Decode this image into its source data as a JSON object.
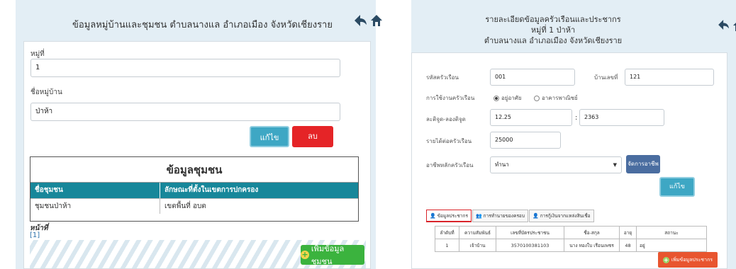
{
  "left": {
    "title": "ข้อมูลหมู่บ้านและชุมชน ตำบลนางแล อำเภอเมือง จังหวัดเชียงราย",
    "village_no_label": "หมู่ที่",
    "village_no_value": "1",
    "village_name_label": "ชื่อหมู่บ้าน",
    "village_name_value": "ป่าห้า",
    "edit_button": "แก้ไข",
    "delete_button": "ลบ",
    "community": {
      "title": "ข้อมูลชุมชน",
      "headers": [
        "ชื่อชุมชน",
        "ลักษณะที่ตั้งในเขตการปกครอง"
      ],
      "rows": [
        [
          "ชุมชนป่าห้า",
          "เขตพื้นที่ อบต"
        ]
      ]
    },
    "pager_label": "หน้าที่",
    "pager_value": "[1]",
    "add_community_button": "เพิ่มข้อมูลชุมชน"
  },
  "right": {
    "title_line1": "รายละเอียดข้อมูลครัวเรือนและประชากร",
    "title_line2": "หมู่ที่ 1  ป่าห้า",
    "title_line3": "ตำบลนางแล อำเภอเมือง จังหวัดเชียงราย",
    "household_code_label": "รหัสครัวเรือน",
    "household_code_value": "001",
    "house_no_label": "บ้านเลขที่",
    "house_no_value": "121",
    "usage_label": "การใช้งานครัวเรือน",
    "usage_options": [
      "อยู่อาศัย",
      "อาคารพาณิชย์"
    ],
    "latlon_label": "ละติจูด-ลองติจูด",
    "lat_value": "12.25",
    "lon_value": "2363",
    "income_label": "รายได้ต่อครัวเรือน",
    "income_value": "25000",
    "occupation_label": "อาชีพหลักครัวเรือน",
    "occupation_value": "ทำนา",
    "manage_occupation_button": "จัดการอาชีพ",
    "edit_button": "แก้ไข",
    "tabs": [
      "ข้อมูลประชากร",
      "การทำนายของครอบ",
      "การกู้เงินจากแหล่งสินเชื่อ"
    ],
    "table_headers": [
      "ลำดับที่",
      "ความสัมพันธ์",
      "เลขที่บัตรประชาชน",
      "ชื่อ-สกุล",
      "อายุ",
      "สถานะ"
    ],
    "table_rows": [
      [
        "1",
        "เจ้าบ้าน",
        "3570100381103",
        "นาง ทองใบ เรือนเพชร",
        "48",
        "อยู่"
      ]
    ],
    "add_population_button": "เพิ่มข้อมูลประชากร"
  }
}
